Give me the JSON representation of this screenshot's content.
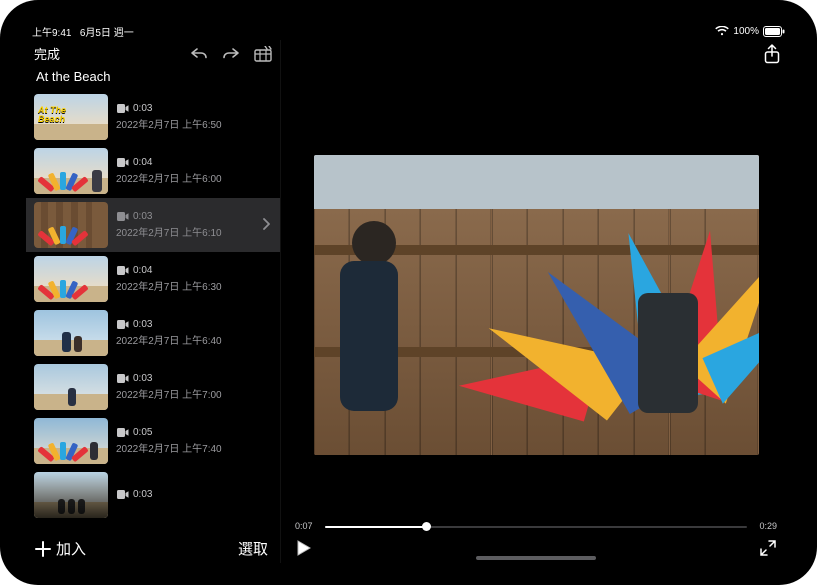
{
  "statusbar": {
    "time": "上午9:41",
    "date": "6月5日 週一",
    "battery": "100%"
  },
  "toolbar": {
    "done": "完成",
    "project_title": "At the Beach"
  },
  "sidebar_bottom": {
    "add": "加入",
    "select": "選取"
  },
  "playback": {
    "current": "0:07",
    "total": "0:29",
    "progress_pct": 24
  },
  "clips": [
    {
      "duration": "0:03",
      "date": "2022年2月7日 上午6:50",
      "title": "At The Beach",
      "selected": false
    },
    {
      "duration": "0:04",
      "date": "2022年2月7日 上午6:00",
      "selected": false
    },
    {
      "duration": "0:03",
      "date": "2022年2月7日 上午6:10",
      "selected": true
    },
    {
      "duration": "0:04",
      "date": "2022年2月7日 上午6:30",
      "selected": false
    },
    {
      "duration": "0:03",
      "date": "2022年2月7日 上午6:40",
      "selected": false
    },
    {
      "duration": "0:03",
      "date": "2022年2月7日 上午7:00",
      "selected": false
    },
    {
      "duration": "0:05",
      "date": "2022年2月7日 上午7:40",
      "selected": false
    },
    {
      "duration": "0:03",
      "date": "",
      "selected": false
    }
  ],
  "kite_colors": [
    "#e4333a",
    "#f2b22e",
    "#2aa6e0",
    "#3564c4",
    "#e4333a",
    "#f2b22e",
    "#2aa6e0"
  ]
}
